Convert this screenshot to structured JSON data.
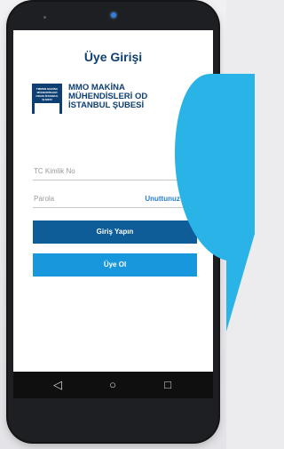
{
  "screen": {
    "title": "Üye Girişi",
    "logo": {
      "badge_text": "TMMOB MAKİNA MÜHENDİSLERİ ODASI İSTANBUL ŞUBESİ",
      "line1": "MMO MAKİNA",
      "line2": "MÜHENDİSLERİ OD",
      "line3": "İSTANBUL ŞUBESİ"
    },
    "tc_field": {
      "placeholder": "TC Kimlik No"
    },
    "password_field": {
      "placeholder": "Parola",
      "forgot_label": "Unuttunuz mu?"
    },
    "login_button": "Giriş Yapın",
    "signup_button": "Üye Ol"
  },
  "navbar": {
    "back_icon": "◁",
    "home_icon": "○",
    "recent_icon": "□"
  },
  "colors": {
    "primary": "#0e5c98",
    "accent": "#1897dc",
    "title": "#0e3f73",
    "bubble": "#2ab3e6"
  }
}
